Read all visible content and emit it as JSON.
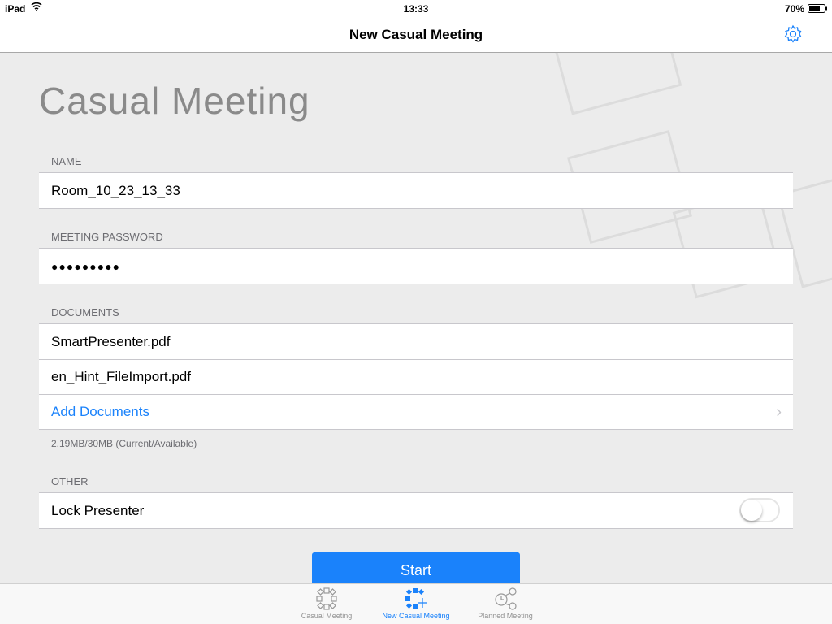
{
  "status": {
    "device": "iPad",
    "time": "13:33",
    "battery": "70%"
  },
  "nav": {
    "title": "New Casual Meeting"
  },
  "page_title": "Casual Meeting",
  "name": {
    "label": "NAME",
    "value": "Room_10_23_13_33"
  },
  "password": {
    "label": "MEETING PASSWORD",
    "value": "●●●●●●●●●"
  },
  "documents": {
    "label": "DOCUMENTS",
    "items": [
      "SmartPresenter.pdf",
      "en_Hint_FileImport.pdf"
    ],
    "add": "Add Documents",
    "usage": "2.19MB/30MB (Current/Available)"
  },
  "other": {
    "label": "OTHER",
    "lock_presenter": "Lock Presenter",
    "lock_presenter_on": false
  },
  "start": "Start",
  "tabs": [
    {
      "label": "Casual Meeting"
    },
    {
      "label": "New Casual Meeting"
    },
    {
      "label": "Planned Meeting"
    }
  ],
  "colors": {
    "accent": "#1a82fb"
  }
}
